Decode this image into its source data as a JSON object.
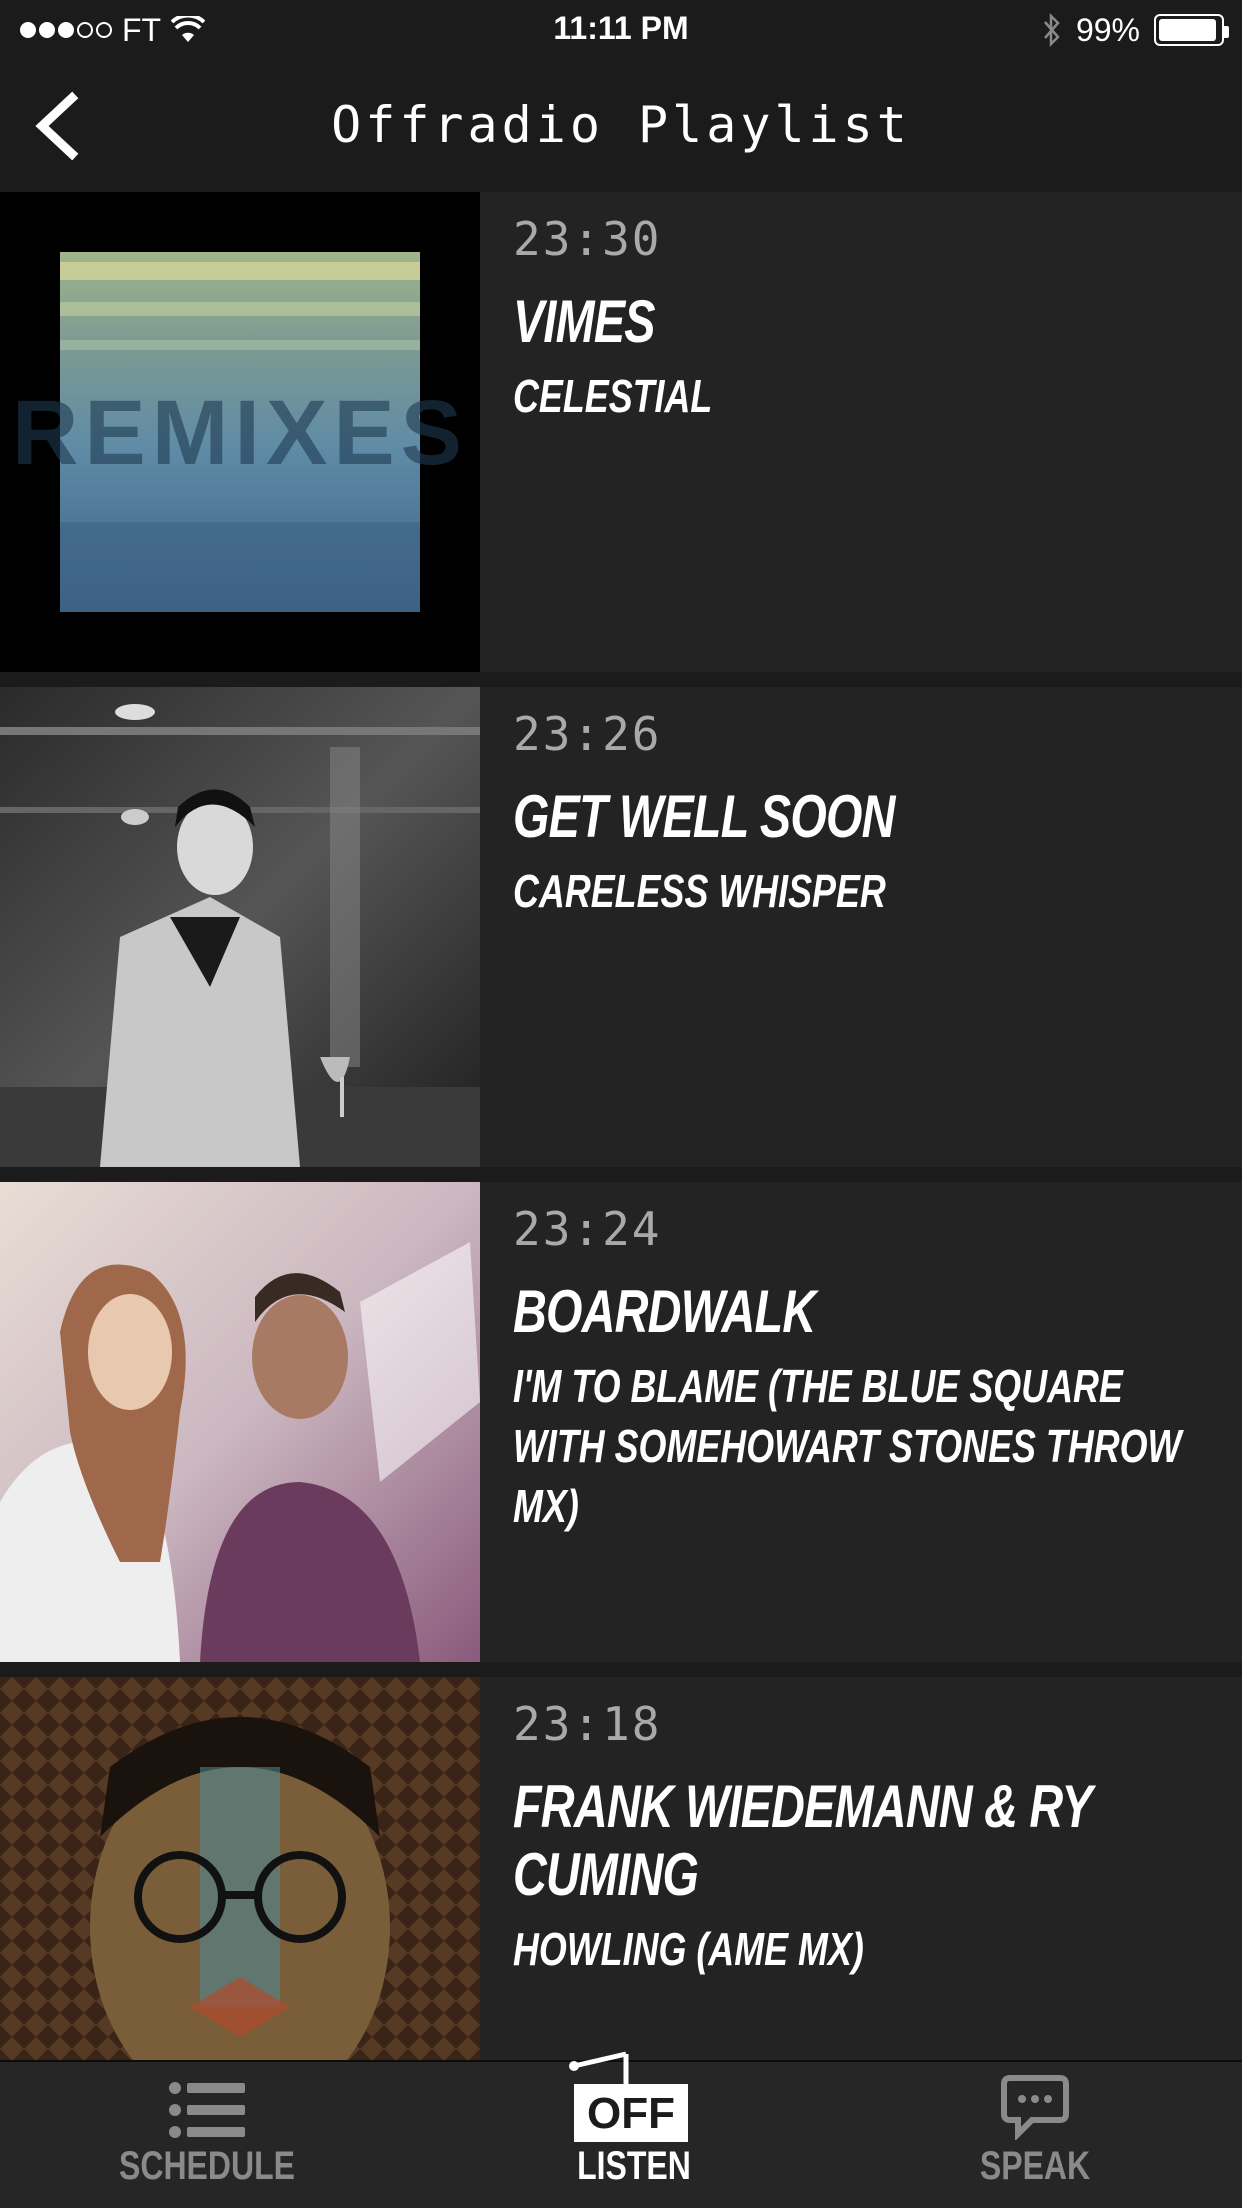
{
  "status_bar": {
    "carrier": "FT",
    "time": "11:11 PM",
    "battery": "99%",
    "signal_bars_filled": 3,
    "signal_bars_total": 5,
    "battery_level": 0.99
  },
  "nav": {
    "title": "Offradio Playlist",
    "back_icon": "chevron-left-icon"
  },
  "playlist": [
    {
      "time": "23:30",
      "artist": "VIMES",
      "track": "CELESTIAL",
      "cover_text": "REMIXES"
    },
    {
      "time": "23:26",
      "artist": "GET WELL SOON",
      "track": "CARELESS WHISPER"
    },
    {
      "time": "23:24",
      "artist": "BOARDWALK",
      "track": "I'M TO BLAME (THE BLUE SQUARE WITH SOMEHOWART STONES THROW MX)"
    },
    {
      "time": "23:18",
      "artist": "FRANK WIEDEMANN & RY CUMING",
      "track": "HOWLING (AME MX)"
    }
  ],
  "tabs": [
    {
      "label": "SCHEDULE",
      "icon": "list-icon",
      "active": false
    },
    {
      "label": "LISTEN",
      "icon": "radio-icon",
      "active": true,
      "badge": "OFF"
    },
    {
      "label": "SPEAK",
      "icon": "chat-bubble-icon",
      "active": false
    }
  ],
  "colors": {
    "background": "#1b1b1b",
    "row_background": "#232323",
    "time_text": "#a9a9a9",
    "tab_inactive": "#8a8a8a",
    "tab_active": "#ffffff"
  }
}
